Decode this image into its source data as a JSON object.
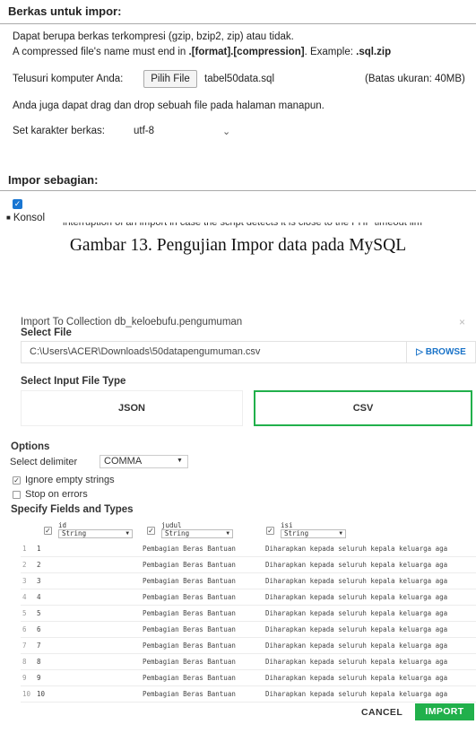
{
  "top_screenshot": {
    "title": "Berkas untuk impor:",
    "line1": "Dapat berupa berkas terkompresi (gzip, bzip2, zip) atau tidak.",
    "line2_prefix": "A compressed file's name must end in ",
    "line2_format": ".[format].[compression]",
    "line2_mid": ". Example: ",
    "line2_example": ".sql.zip",
    "browse_label": "Telusuri komputer Anda:",
    "browse_button": "Pilih File",
    "file_name": "tabel50data.sql",
    "size_limit": "(Batas ukuran: 40MB)",
    "drag_hint": "Anda juga dapat drag dan drop sebuah file pada halaman manapun.",
    "charset_label": "Set karakter berkas:",
    "charset_value": "utf-8",
    "partial_title": "Impor sebagian:",
    "checkbox_checked": true,
    "konsol_label": "Konsol",
    "cut_text": "interruption of an import in case the script detects it is close to the PHP timeout lim"
  },
  "caption_1": "Gambar 13. Pengujian Impor data pada MySQL",
  "dialog": {
    "title": "Import To Collection db_keloebufu.pengumuman",
    "close_icon": "×",
    "select_file_label": "Select File",
    "file_path": "C:\\Users\\ACER\\Downloads\\50datapengumuman.csv",
    "browse_button": "BROWSE",
    "input_type_label": "Select Input File Type",
    "type_json": "JSON",
    "type_csv": "CSV",
    "selected_type": "CSV",
    "options_label": "Options",
    "delimiter_label": "Select delimiter",
    "delimiter_value": "COMMA",
    "ignore_empty_label": "Ignore empty strings",
    "ignore_empty_checked": true,
    "stop_on_errors_label": "Stop on errors",
    "stop_on_errors_checked": false,
    "fields_label": "Specify Fields and Types",
    "columns": [
      {
        "name": "id",
        "type": "String",
        "checked": true
      },
      {
        "name": "judul",
        "type": "String",
        "checked": true
      },
      {
        "name": "isi",
        "type": "String",
        "checked": true
      }
    ],
    "rows": [
      {
        "n": "1",
        "id": "1",
        "judul": "Pembagian Beras Bantuan",
        "isi": "Diharapkan kepada seluruh kepala keluarga aga"
      },
      {
        "n": "2",
        "id": "2",
        "judul": "Pembagian Beras Bantuan",
        "isi": "Diharapkan kepada seluruh kepala keluarga aga"
      },
      {
        "n": "3",
        "id": "3",
        "judul": "Pembagian Beras Bantuan",
        "isi": "Diharapkan kepada seluruh kepala keluarga aga"
      },
      {
        "n": "4",
        "id": "4",
        "judul": "Pembagian Beras Bantuan",
        "isi": "Diharapkan kepada seluruh kepala keluarga aga"
      },
      {
        "n": "5",
        "id": "5",
        "judul": "Pembagian Beras Bantuan",
        "isi": "Diharapkan kepada seluruh kepala keluarga aga"
      },
      {
        "n": "6",
        "id": "6",
        "judul": "Pembagian Beras Bantuan",
        "isi": "Diharapkan kepada seluruh kepala keluarga aga"
      },
      {
        "n": "7",
        "id": "7",
        "judul": "Pembagian Beras Bantuan",
        "isi": "Diharapkan kepada seluruh kepala keluarga aga"
      },
      {
        "n": "8",
        "id": "8",
        "judul": "Pembagian Beras Bantuan",
        "isi": "Diharapkan kepada seluruh kepala keluarga aga"
      },
      {
        "n": "9",
        "id": "9",
        "judul": "Pembagian Beras Bantuan",
        "isi": "Diharapkan kepada seluruh kepala keluarga aga"
      },
      {
        "n": "10",
        "id": "10",
        "judul": "Pembagian Beras Bantuan",
        "isi": "Diharapkan kepada seluruh kepala keluarga aga"
      }
    ],
    "cancel_button": "CANCEL",
    "import_button": "IMPORT"
  },
  "colors": {
    "accent_green": "#21b04b",
    "link_blue": "#1a73c8",
    "checkbox_blue": "#1976d2"
  }
}
